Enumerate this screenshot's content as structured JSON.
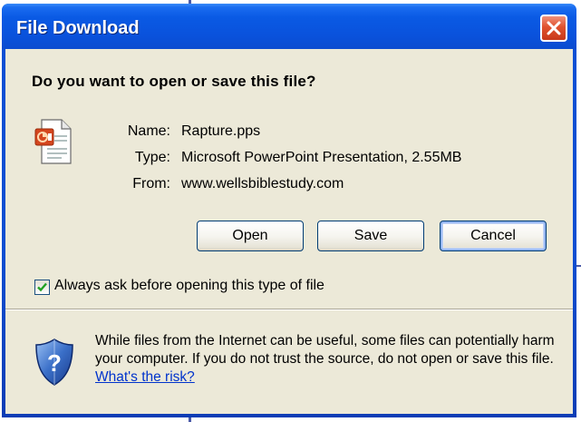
{
  "window": {
    "title": "File Download"
  },
  "dialog": {
    "question": "Do you want to open or save this file?",
    "file_icon": "powerpoint-show-icon",
    "info": [
      {
        "label": "Name:",
        "value": "Rapture.pps"
      },
      {
        "label": "Type:",
        "value": "Microsoft PowerPoint Presentation, 2.55MB"
      },
      {
        "label": "From:",
        "value": "www.wellsbiblestudy.com"
      }
    ],
    "buttons": {
      "open": "Open",
      "save": "Save",
      "cancel": "Cancel"
    },
    "checkbox": {
      "label": "Always ask before opening this type of file",
      "checked": true
    },
    "warning": {
      "icon": "shield-icon",
      "text": "While files from the Internet can be useful, some files can potentially harm your computer. If you do not trust the source, do not open or save this file.",
      "link": "What's the risk?"
    }
  },
  "colors": {
    "title_bar": "#0a52dc",
    "dialog_body": "#ece9d8",
    "close_button": "#e0522e",
    "link": "#0033cc"
  }
}
